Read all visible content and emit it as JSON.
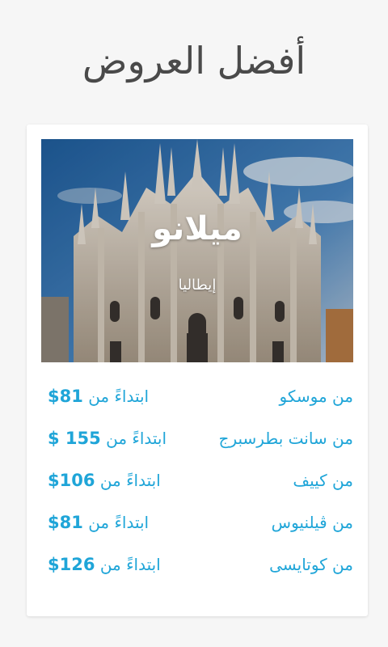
{
  "header": {
    "title": "أفضل العروض"
  },
  "deal": {
    "city": "ميلانو",
    "country": "إيطاليا",
    "offers": [
      {
        "from": "من موسكو",
        "starting": "ابتداءً من",
        "price": "$81"
      },
      {
        "from": "من سانت بطرسبرج",
        "starting": "ابتداءً من",
        "price": "$ 155"
      },
      {
        "from": "من كييف",
        "starting": "ابتداءً من",
        "price": "$106"
      },
      {
        "from": "من ڤيلنيوس",
        "starting": "ابتداءً من",
        "price": "$81"
      },
      {
        "from": "من كوتايسى",
        "starting": "ابتداءً من",
        "price": "$126"
      }
    ]
  },
  "colors": {
    "accent": "#1fa5d8",
    "title": "#4a4a4a",
    "background": "#f6f6f6"
  }
}
